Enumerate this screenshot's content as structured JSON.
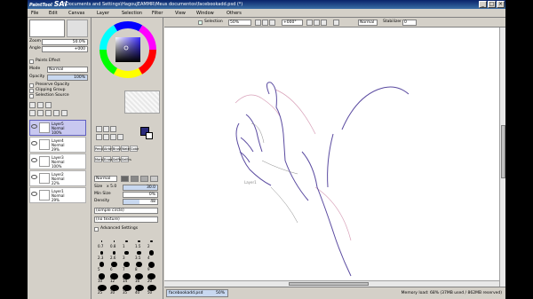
{
  "app": {
    "logo": "PaintTool",
    "logo_sai": "SAI",
    "window_title": "C:\\Documents and Settings\\HagouJEAMMR\\Meus documentos\\facebookadd.psd (*)"
  },
  "menu": [
    "File",
    "Edit",
    "Canvas",
    "Layer",
    "Selection",
    "Filter",
    "View",
    "Window",
    "Others"
  ],
  "navigator": {
    "zoom_label": "Zoom",
    "zoom_value": "50.0%",
    "angle_label": "Angle",
    "angle_value": "+000"
  },
  "layer_props": {
    "effect_label": "Paints Effect",
    "mode_label": "Mode",
    "mode_value": "Normal",
    "opacity_label": "Opacity",
    "opacity_value": "100%",
    "preserve_opacity": "Preserve Opacity",
    "clipping_group": "Clipping Group",
    "selection_source": "Selection Source"
  },
  "layers": [
    {
      "name": "Layer5",
      "mode": "Normal",
      "opacity": "100%",
      "selected": true
    },
    {
      "name": "Layer4",
      "mode": "Normal",
      "opacity": "29%",
      "selected": false
    },
    {
      "name": "Layer3",
      "mode": "Normal",
      "opacity": "100%",
      "selected": false
    },
    {
      "name": "Layer2",
      "mode": "Normal",
      "opacity": "22%",
      "selected": false
    },
    {
      "name": "Layer1",
      "mode": "Normal",
      "opacity": "29%",
      "selected": false
    }
  ],
  "tools": {
    "row1": [
      "Pencil",
      "Airbrush",
      "Brush",
      "Water",
      "Color"
    ],
    "row2": [
      "Marker",
      "Eraser",
      "SelPen",
      "SelErs"
    ],
    "brush_mode": "Normal",
    "size_label": "Size",
    "size_mult": "x 5.0",
    "size_value": "30.0",
    "min_size_label": "Min Size",
    "min_size_value": "0%",
    "density_label": "Density",
    "density_value": "48",
    "shape_value": "(simple circle)",
    "texture_value": "(no texture)",
    "advanced_label": "Advanced Settings",
    "size_presets": [
      "0.7",
      "0.8",
      "1",
      "1.5",
      "2",
      "2.3",
      "2.6",
      "3",
      "3.5",
      "4",
      "5",
      "6",
      "7",
      "8",
      "9",
      "10",
      "12",
      "14",
      "16",
      "20",
      "25",
      "30",
      "35",
      "40",
      "50"
    ]
  },
  "canvas_toolbar": {
    "selection_label": "Selection",
    "zoom_value": "50%",
    "angle_value": "+000°",
    "mode_value": "Normal",
    "stabilizer_label": "Stabilizer",
    "stabilizer_value": "0"
  },
  "canvas": {
    "layer_label": "Layer1"
  },
  "statusbar": {
    "doc_tab": "facebookadd.psd",
    "doc_zoom": "50%",
    "memory": "Memory load: 68% (37MB used / 862MB reserved)"
  },
  "colors": {
    "accent": "#0a246a",
    "current_color": "#2a2a7a",
    "selected_layer": "#c8c8f0"
  }
}
